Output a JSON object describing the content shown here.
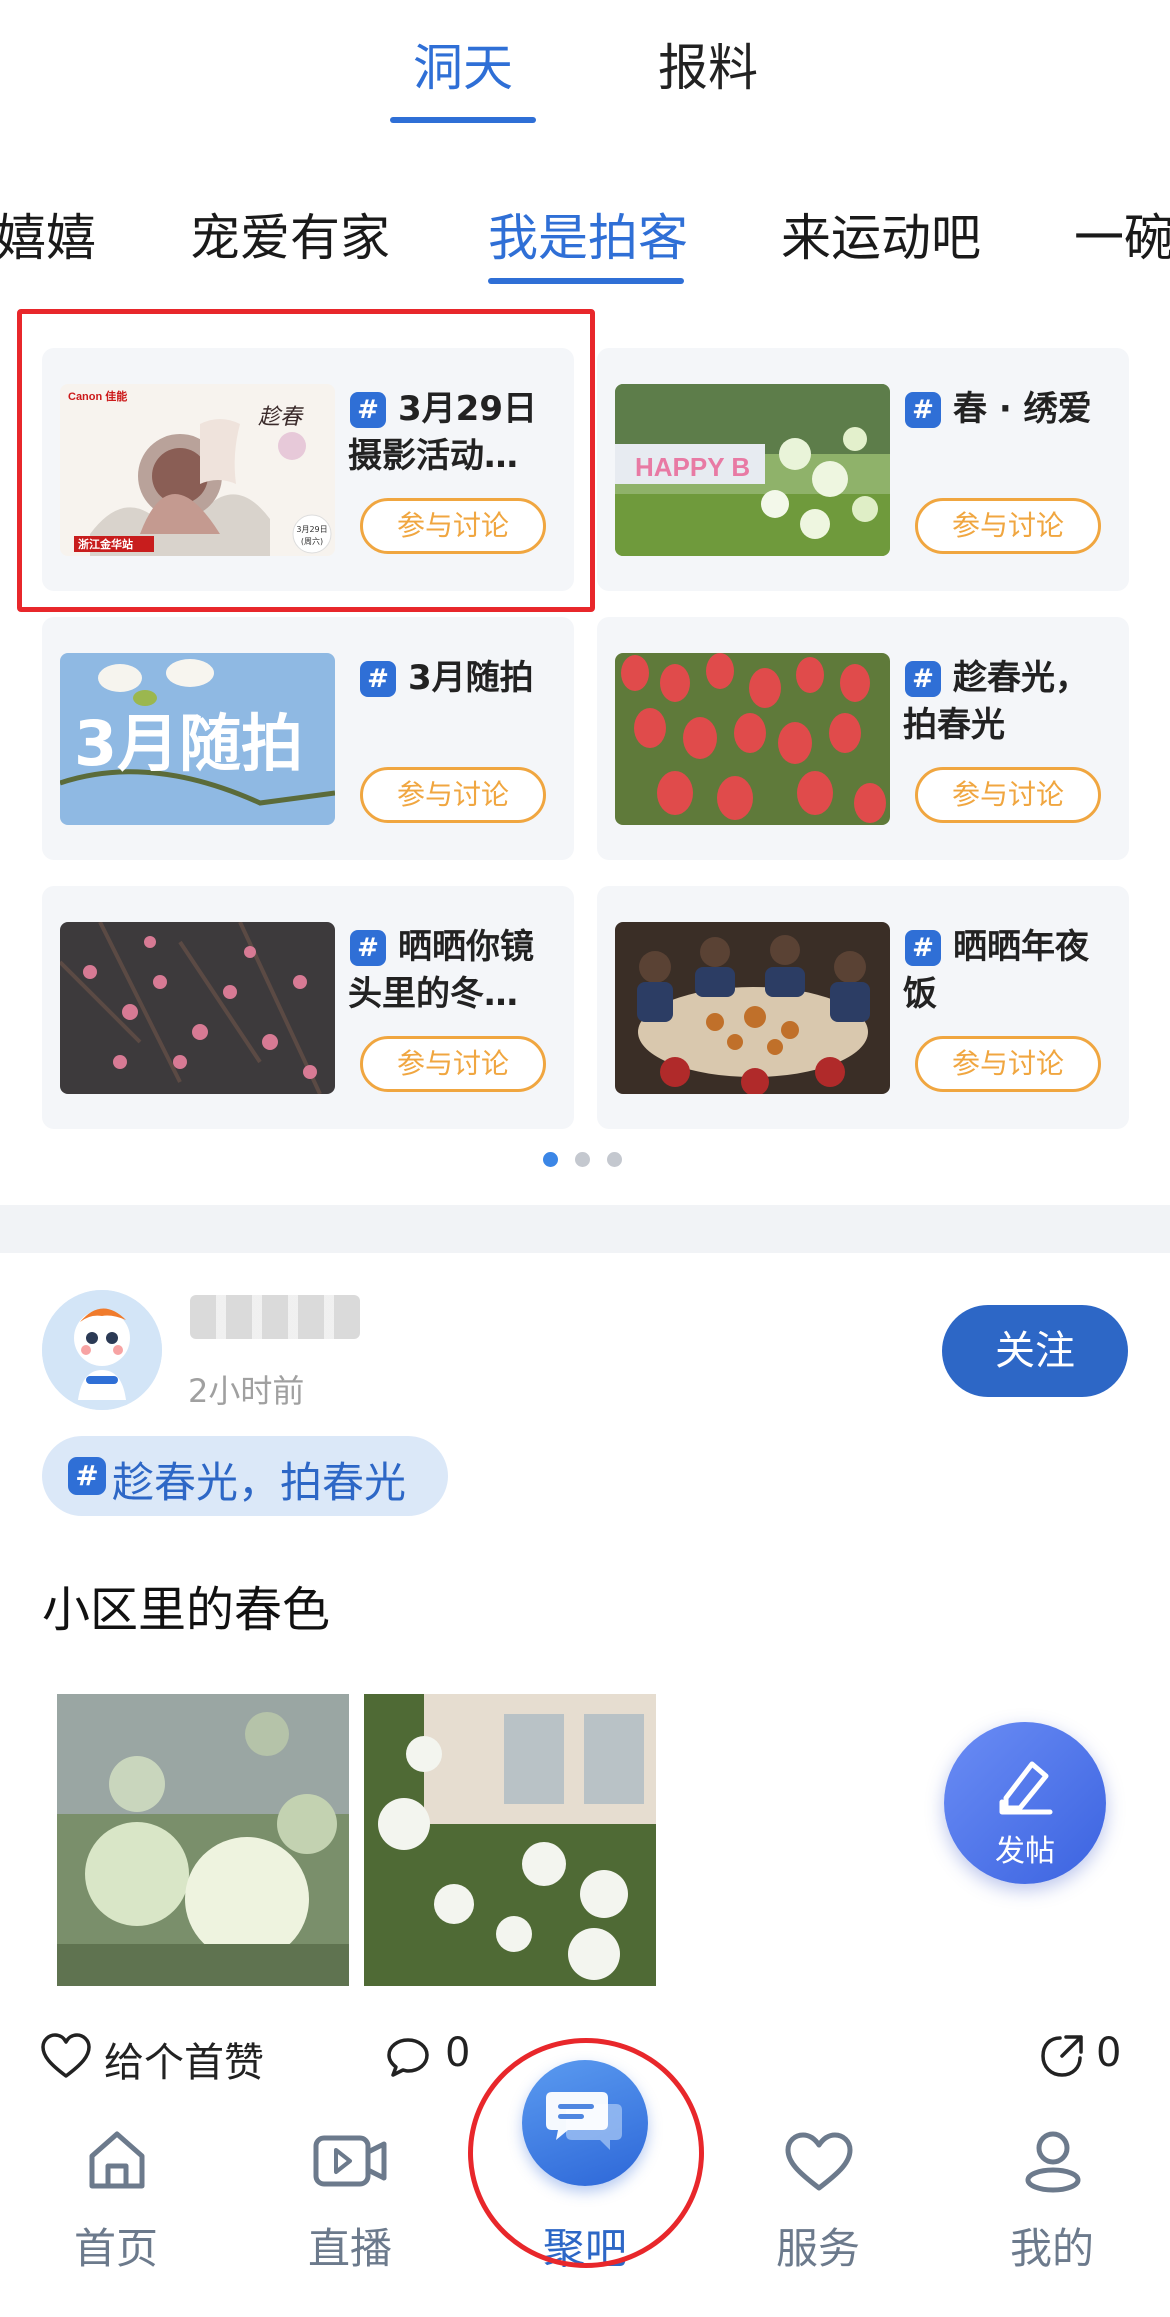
{
  "top_tabs": [
    {
      "label": "洞天",
      "active": true
    },
    {
      "label": "报料",
      "active": false
    }
  ],
  "category_tabs": [
    {
      "label": "嬉嬉",
      "active": false
    },
    {
      "label": "宠爱有家",
      "active": false
    },
    {
      "label": "我是拍客",
      "active": true
    },
    {
      "label": "来运动吧",
      "active": false
    },
    {
      "label": "一碗",
      "active": false
    }
  ],
  "topic_cards": [
    {
      "title": "3月29日摄影活动…",
      "button": "参与讨论",
      "image": "canon-poster",
      "poster": {
        "brand": "Canon 佳能",
        "date": "3月29日",
        "weekday": "(周六)",
        "station": "浙江金华站"
      }
    },
    {
      "title": "春 · 绣爱",
      "button": "参与讨论",
      "image": "garden-flowers"
    },
    {
      "title": "3月随拍",
      "button": "参与讨论",
      "image": "magnolia-banner",
      "banner_text": "3月随拍"
    },
    {
      "title": "趁春光，拍春光",
      "button": "参与讨论",
      "image": "tulips"
    },
    {
      "title": "晒晒你镜头里的冬…",
      "button": "参与讨论",
      "image": "plum-blossom"
    },
    {
      "title": "晒晒年夜饭",
      "button": "参与讨论",
      "image": "family-dinner"
    }
  ],
  "pager": {
    "count": 3,
    "active_index": 0
  },
  "post": {
    "time": "2小时前",
    "follow_label": "关注",
    "topic": "趁春光，拍春光",
    "text": "小区里的春色",
    "like_label": "给个首赞",
    "comment_count": "0",
    "share_count": "0"
  },
  "fab": {
    "label": "发帖",
    "icon": "edit-icon"
  },
  "bottom_nav": [
    {
      "label": "首页",
      "icon": "home-icon",
      "active": false
    },
    {
      "label": "直播",
      "icon": "video-icon",
      "active": false
    },
    {
      "label": "聚吧",
      "icon": "chat-icon",
      "active": true
    },
    {
      "label": "服务",
      "icon": "heart-icon",
      "active": false
    },
    {
      "label": "我的",
      "icon": "person-icon",
      "active": false
    }
  ],
  "colors": {
    "accent": "#2f6fd6",
    "button_orange": "#f0a640",
    "highlight_red": "#e8272b"
  }
}
